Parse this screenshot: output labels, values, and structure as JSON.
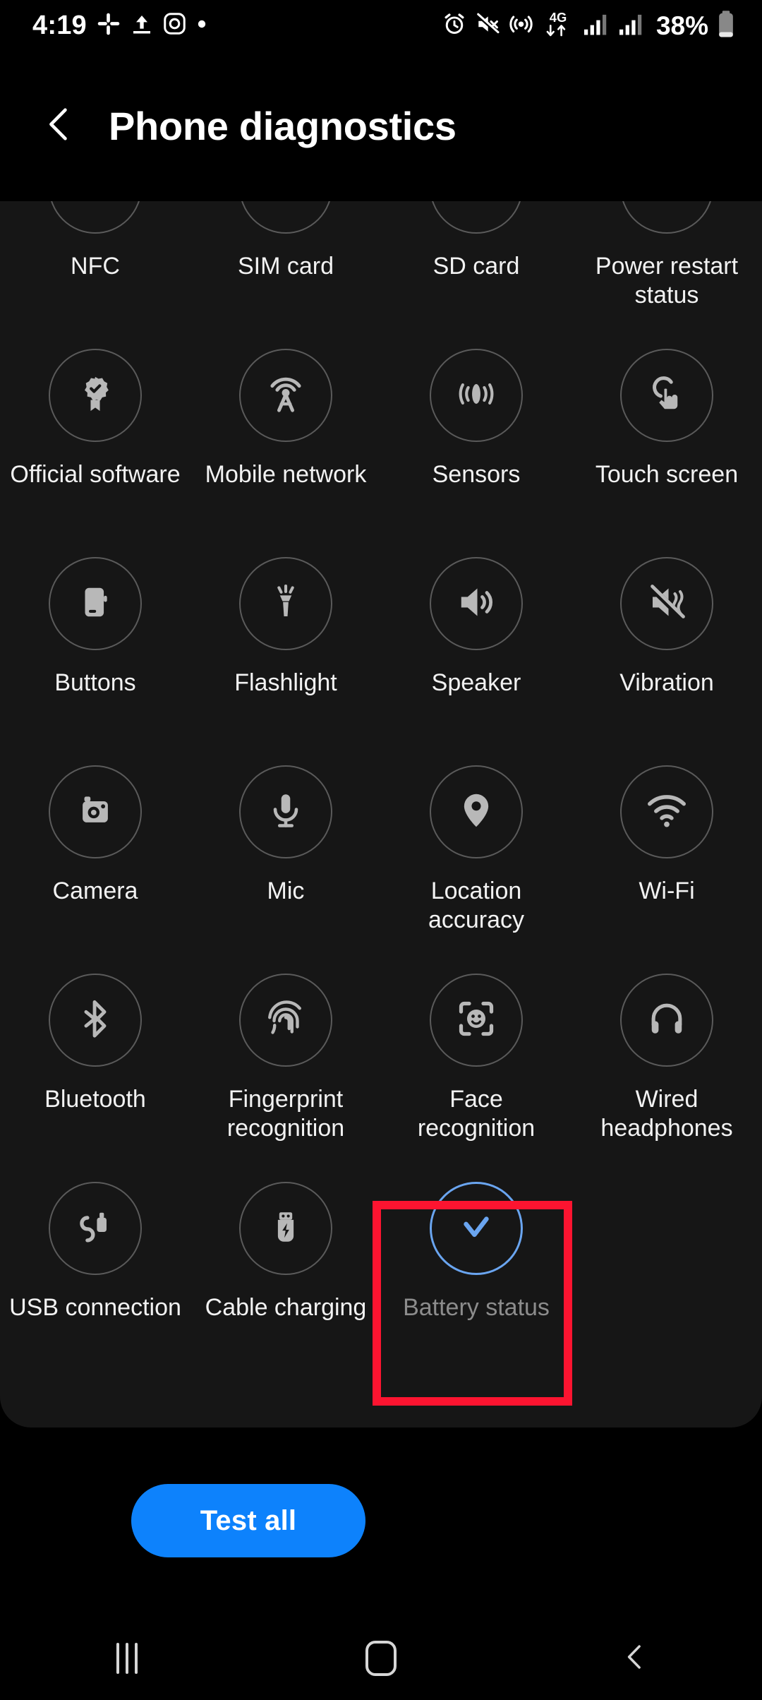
{
  "status_bar": {
    "time": "4:19",
    "battery_percent": "38%",
    "left_icons": [
      "slack-icon",
      "upload-icon",
      "instagram-icon",
      "dot-icon"
    ],
    "right_icons": [
      "alarm-icon",
      "mute-icon",
      "hotspot-icon",
      "4g-data-icon",
      "signal-bars-icon",
      "signal-bars-2-icon",
      "battery-icon"
    ],
    "network_label": "4G"
  },
  "header": {
    "title": "Phone diagnostics",
    "back_icon": "chevron-left-icon"
  },
  "grid": {
    "items": [
      {
        "label": "NFC",
        "icon": "nfc-icon",
        "state": "pending"
      },
      {
        "label": "SIM card",
        "icon": "sim-card-icon",
        "state": "pending"
      },
      {
        "label": "SD card",
        "icon": "sd-card-icon",
        "state": "pending"
      },
      {
        "label": "Power restart status",
        "icon": "power-restart-icon",
        "state": "pending"
      },
      {
        "label": "Official software",
        "icon": "verified-badge-icon",
        "state": "pending"
      },
      {
        "label": "Mobile network",
        "icon": "antenna-icon",
        "state": "pending"
      },
      {
        "label": "Sensors",
        "icon": "sensors-icon",
        "state": "pending"
      },
      {
        "label": "Touch screen",
        "icon": "touch-screen-icon",
        "state": "pending"
      },
      {
        "label": "Buttons",
        "icon": "phone-buttons-icon",
        "state": "pending"
      },
      {
        "label": "Flashlight",
        "icon": "flashlight-icon",
        "state": "pending"
      },
      {
        "label": "Speaker",
        "icon": "speaker-icon",
        "state": "pending"
      },
      {
        "label": "Vibration",
        "icon": "vibration-mute-icon",
        "state": "pending"
      },
      {
        "label": "Camera",
        "icon": "camera-icon",
        "state": "pending"
      },
      {
        "label": "Mic",
        "icon": "microphone-icon",
        "state": "pending"
      },
      {
        "label": "Location accuracy",
        "icon": "location-pin-icon",
        "state": "pending"
      },
      {
        "label": "Wi-Fi",
        "icon": "wifi-icon",
        "state": "pending"
      },
      {
        "label": "Bluetooth",
        "icon": "bluetooth-icon",
        "state": "pending"
      },
      {
        "label": "Fingerprint recognition",
        "icon": "fingerprint-icon",
        "state": "pending"
      },
      {
        "label": "Face recognition",
        "icon": "face-recognition-icon",
        "state": "pending"
      },
      {
        "label": "Wired headphones",
        "icon": "headphones-icon",
        "state": "pending"
      },
      {
        "label": "USB connection",
        "icon": "usb-cable-icon",
        "state": "pending"
      },
      {
        "label": "Cable charging",
        "icon": "usb-charging-icon",
        "state": "pending"
      },
      {
        "label": "Battery status",
        "icon": "check-icon",
        "state": "completed"
      }
    ]
  },
  "footer": {
    "test_all_label": "Test all"
  },
  "nav_bar": {
    "recents_icon": "recents-icon",
    "home_icon": "home-icon",
    "back_icon": "nav-back-icon"
  },
  "annotation": {
    "target_label": "Battery status",
    "color": "#fc1430"
  },
  "theme": {
    "accent_blue": "#0d82fc",
    "completed_blue": "#6aa5f0",
    "card_bg": "#161616",
    "page_bg": "#000000",
    "circle_border": "#5a5a5a"
  }
}
